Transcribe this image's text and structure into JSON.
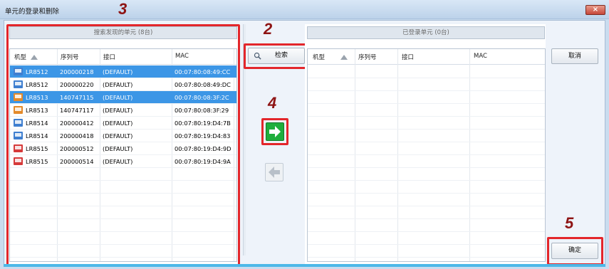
{
  "window": {
    "title": "单元的登录和删除",
    "close_label": "×"
  },
  "left_panel": {
    "header": "搜索发现的单元 (8台)",
    "columns": [
      "机型",
      "序列号",
      "接口",
      "MAC"
    ],
    "rows": [
      {
        "model": "LR8512",
        "serial": "200000218",
        "iface": "(DEFAULT)",
        "mac": "00:07:80:08:49:CC",
        "selected": true
      },
      {
        "model": "LR8512",
        "serial": "200000220",
        "iface": "(DEFAULT)",
        "mac": "00:07:80:08:49:DC",
        "selected": false
      },
      {
        "model": "LR8513",
        "serial": "140747115",
        "iface": "(DEFAULT)",
        "mac": "00:07:80:08:3F:2C",
        "selected": true
      },
      {
        "model": "LR8513",
        "serial": "140747117",
        "iface": "(DEFAULT)",
        "mac": "00:07:80:08:3F:29",
        "selected": false
      },
      {
        "model": "LR8514",
        "serial": "200000412",
        "iface": "(DEFAULT)",
        "mac": "00:07:80:19:D4:7B",
        "selected": false
      },
      {
        "model": "LR8514",
        "serial": "200000418",
        "iface": "(DEFAULT)",
        "mac": "00:07:80:19:D4:83",
        "selected": false
      },
      {
        "model": "LR8515",
        "serial": "200000512",
        "iface": "(DEFAULT)",
        "mac": "00:07:80:19:D4:9D",
        "selected": false
      },
      {
        "model": "LR8515",
        "serial": "200000514",
        "iface": "(DEFAULT)",
        "mac": "00:07:80:19:D4:9A",
        "selected": false
      }
    ],
    "icon_colors": [
      "#3f7fd0",
      "#3f7fd0",
      "#e48a2a",
      "#e48a2a",
      "#3f7fd0",
      "#3f7fd0",
      "#d63a3a",
      "#d63a3a"
    ]
  },
  "right_panel": {
    "header": "已登录单元 (0台)",
    "columns": [
      "机型",
      "序列号",
      "接口",
      "MAC"
    ]
  },
  "buttons": {
    "search": "检索",
    "cancel": "取消",
    "ok": "确定",
    "add_icon": "arrow-right-icon",
    "remove_icon": "arrow-left-icon"
  },
  "callouts": {
    "n2": "2",
    "n3": "3",
    "n4": "4",
    "n5": "5"
  },
  "colors": {
    "highlight": "#e3262b",
    "selection": "#3c96e6",
    "add_green": "#1fae3c"
  }
}
